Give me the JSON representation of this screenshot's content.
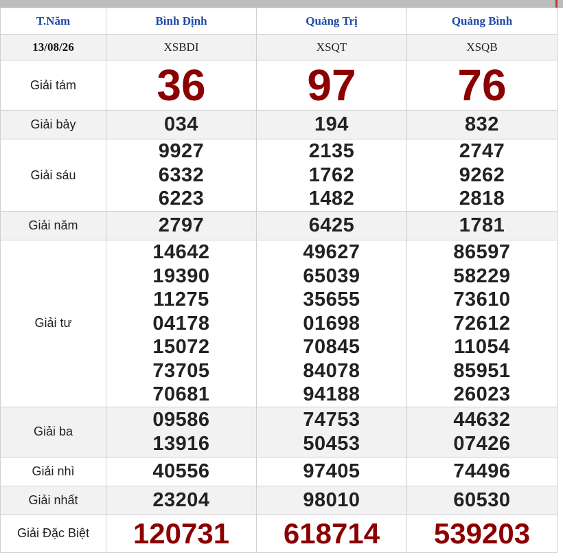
{
  "header": {
    "day": "T.Năm",
    "provinces": [
      "Bình Định",
      "Quảng Trị",
      "Quảng Bình"
    ]
  },
  "codes_row": {
    "date": "13/08/26",
    "codes": [
      "XSBDI",
      "XSQT",
      "XSQB"
    ]
  },
  "prizes": {
    "g8": {
      "label": "Giải tám",
      "values": [
        "36",
        "97",
        "76"
      ]
    },
    "g7": {
      "label": "Giải bảy",
      "values": [
        "034",
        "194",
        "832"
      ]
    },
    "g6": {
      "label": "Giải sáu",
      "values": [
        [
          "9927",
          "6332",
          "6223"
        ],
        [
          "2135",
          "1762",
          "1482"
        ],
        [
          "2747",
          "9262",
          "2818"
        ]
      ]
    },
    "g5": {
      "label": "Giải năm",
      "values": [
        "2797",
        "6425",
        "1781"
      ]
    },
    "g4": {
      "label": "Giải tư",
      "values": [
        [
          "14642",
          "19390",
          "11275",
          "04178",
          "15072",
          "73705",
          "70681"
        ],
        [
          "49627",
          "65039",
          "35655",
          "01698",
          "70845",
          "84078",
          "94188"
        ],
        [
          "86597",
          "58229",
          "73610",
          "72612",
          "11054",
          "85951",
          "26023"
        ]
      ]
    },
    "g3": {
      "label": "Giải ba",
      "values": [
        [
          "09586",
          "13916"
        ],
        [
          "74753",
          "50453"
        ],
        [
          "44632",
          "07426"
        ]
      ]
    },
    "g2": {
      "label": "Giải nhì",
      "values": [
        "40556",
        "97405",
        "74496"
      ]
    },
    "g1": {
      "label": "Giải nhất",
      "values": [
        "23204",
        "98010",
        "60530"
      ]
    },
    "db": {
      "label": "Giải Đặc Biệt",
      "values": [
        "120731",
        "618714",
        "539203"
      ]
    }
  },
  "colors": {
    "header_text": "#1f4aa8",
    "special_red": "#8b0000",
    "alt_row": "#f2f2f2",
    "border": "#cfcfcf"
  }
}
